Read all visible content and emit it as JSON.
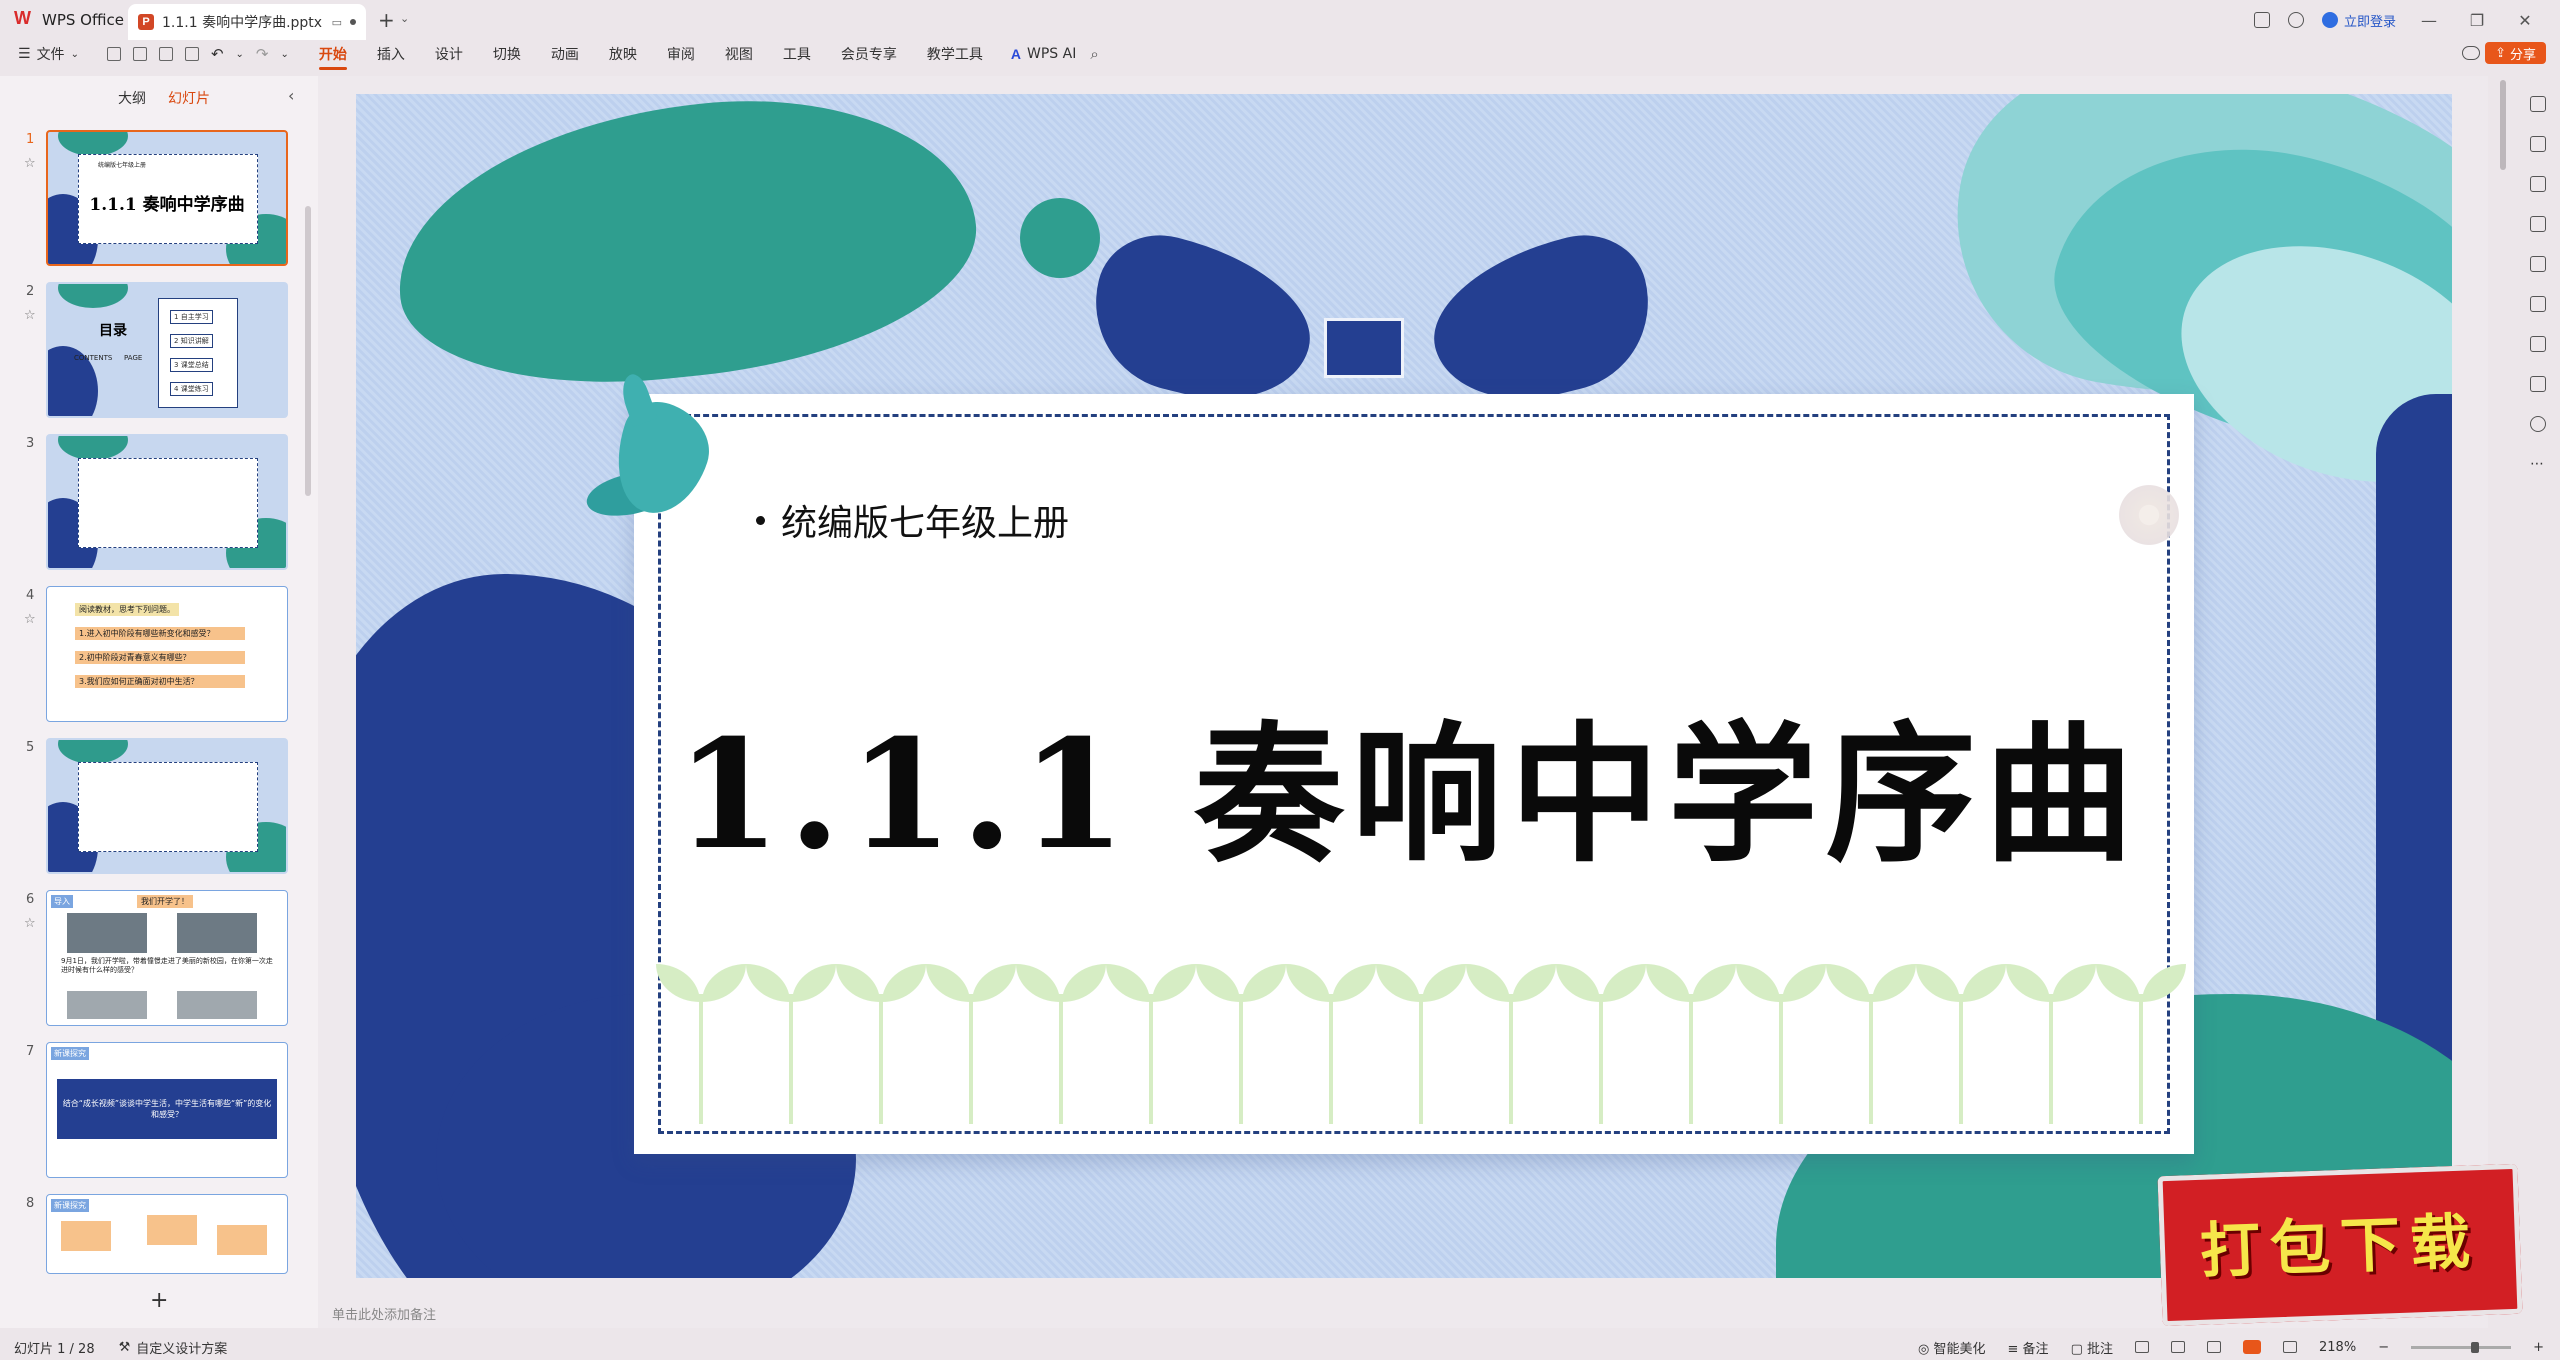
{
  "titlebar": {
    "app_name": "WPS Office",
    "doc_tab_title": "1.1.1 奏响中学序曲.pptx",
    "login_label": "立即登录"
  },
  "menubar": {
    "file_label": "文件",
    "tabs": [
      "开始",
      "插入",
      "设计",
      "切换",
      "动画",
      "放映",
      "审阅",
      "视图",
      "工具",
      "会员专享",
      "教学工具"
    ],
    "active_tab": "开始",
    "wps_ai_label": "WPS AI",
    "share_label": "分享"
  },
  "left_panel": {
    "tabs": [
      "大纲",
      "幻灯片"
    ],
    "active_tab": "幻灯片",
    "slide_numbers": [
      "1",
      "2",
      "3",
      "4",
      "5",
      "6",
      "7",
      "8"
    ],
    "thumb1_small": "统编版七年级上册",
    "thumb1_title": "1.1.1 奏响中学序曲",
    "thumb2_title": "目录",
    "thumb2_contents": "CONTENTS",
    "thumb2_page": "PAGE",
    "thumb2_items": [
      "自主学习",
      "知识讲解",
      "课堂总结",
      "课堂练习"
    ],
    "thumb2_nums": [
      "1",
      "2",
      "3",
      "4"
    ],
    "thumb4_header": "阅读教材，思考下列问题。",
    "thumb4_items": [
      "1.进入初中阶段有哪些新变化和感受？",
      "2.初中阶段对青春意义有哪些？",
      "3.我们应如何正确面对初中生活？"
    ],
    "thumb6_tag": "导入",
    "thumb6_header": "我们开学了！",
    "thumb6_text": "9月1日，我们开学啦，带着憧憬走进了美丽的新校园，在你第一次走进时候有什么样的感受？",
    "thumb7_tag": "新课探究",
    "thumb7_text": "结合“成长视频”谈谈中学生活，中学生活有哪些“新”的变化和感受？",
    "thumb8_tag": "新课探究"
  },
  "slide": {
    "subtitle": "统编版七年级上册",
    "title": "1.1.1 奏响中学序曲"
  },
  "notes_placeholder": "单击此处添加备注",
  "promo_text": "打包下载",
  "statusbar": {
    "slide_counter": "幻灯片 1 / 28",
    "design_label": "自定义设计方案",
    "beautify_label": "智能美化",
    "notes_label": "备注",
    "comment_label": "批注",
    "zoom": "218%"
  },
  "colors": {
    "accent": "#d9480f",
    "navy": "#243f91",
    "teal": "#2f9e8f",
    "slide_bg": "#c8d9f2",
    "promo_red": "#d21f24"
  },
  "icons": [
    "wps-logo-icon",
    "ppt-file-icon",
    "search-icon",
    "cloud-icon",
    "share-icon",
    "collapse-icon",
    "star-icon",
    "add-icon"
  ]
}
